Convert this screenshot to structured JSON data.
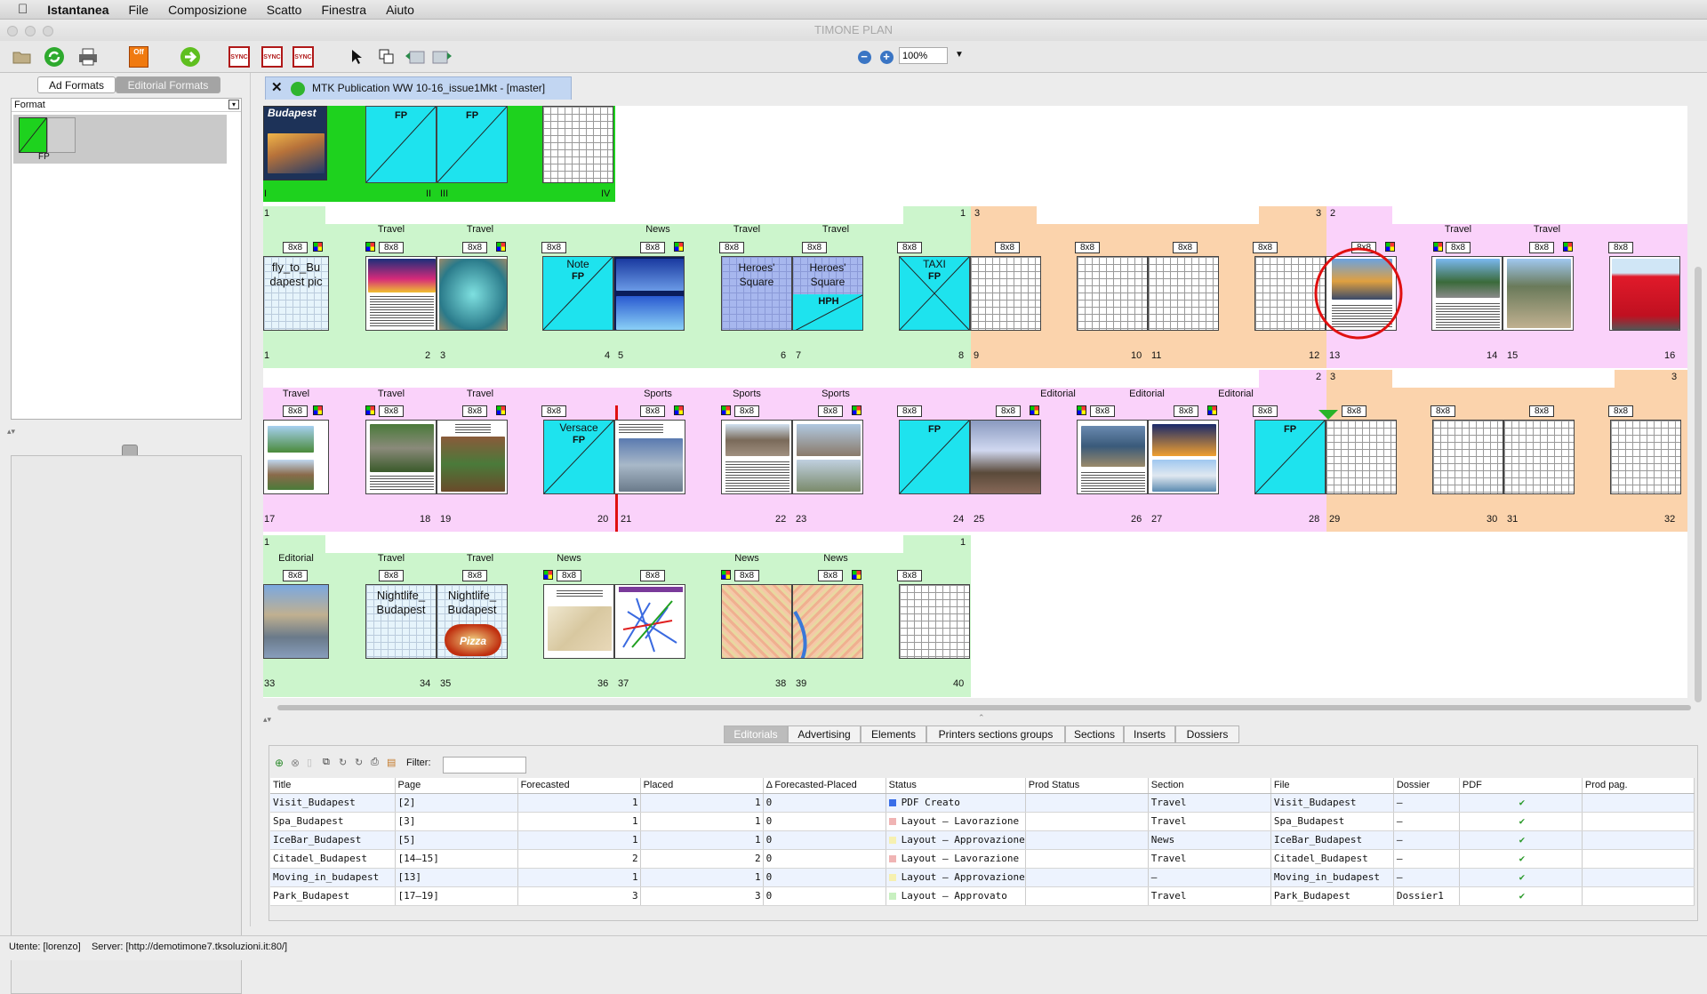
{
  "menubar": {
    "app": "Istantanea",
    "items": [
      "File",
      "Composizione",
      "Scatto",
      "Finestra",
      "Aiuto"
    ]
  },
  "window": {
    "title": "TIMONE PLAN"
  },
  "toolbar": {
    "zoom": "100%",
    "sync_label": "SYNC",
    "off_label": "Off"
  },
  "left_panel": {
    "tabs": [
      "Ad Formats",
      "Editorial Formats"
    ],
    "format_header": "Format",
    "format_item": "FP"
  },
  "doc_tab": {
    "title": "MTK Publication WW 10-16_issue1Mkt - [master]"
  },
  "flatplan": {
    "row0": {
      "labels": [
        "FP",
        "FP"
      ],
      "numbers": [
        "I",
        "II",
        "III",
        "IV"
      ],
      "cover_text": "Budapest"
    },
    "row1": {
      "sections": [
        "Travel",
        "Travel",
        "News",
        "Travel",
        "Travel",
        "Travel",
        "Travel"
      ],
      "tags": [
        "8x8",
        "8x8",
        "8x8",
        "8x8",
        "8x8",
        "8x8",
        "8x8",
        "8x8",
        "8x8",
        "8x8",
        "8x8",
        "8x8",
        "8x8",
        "8x8",
        "8x8",
        "8x8"
      ],
      "numbers": [
        "1",
        "2",
        "3",
        "4",
        "5",
        "6",
        "7",
        "8",
        "9",
        "10",
        "11",
        "12",
        "13",
        "14",
        "15",
        "16"
      ],
      "markers": [
        "1",
        "1",
        "3",
        "3",
        "2"
      ],
      "p1_text": "fly_to_Bu dapest pic",
      "p4_text": "Note",
      "p4_fp": "FP",
      "p6_text": "Heroes' Square",
      "p7_text": "Heroes' Square",
      "p7_hph": "HPH",
      "p8_text": "TAXI",
      "p8_fp": "FP"
    },
    "row2": {
      "sections": [
        "Travel",
        "Travel",
        "Travel",
        "Sports",
        "Sports",
        "Sports",
        "Editorial",
        "Editorial",
        "Editorial"
      ],
      "tags": [
        "8x8",
        "8x8",
        "8x8",
        "8x8",
        "8x8",
        "8x8",
        "8x8",
        "8x8",
        "8x8",
        "8x8",
        "8x8",
        "8x8",
        "8x8",
        "8x8",
        "8x8",
        "8x8"
      ],
      "numbers": [
        "17",
        "18",
        "19",
        "20",
        "21",
        "22",
        "23",
        "24",
        "25",
        "26",
        "27",
        "28",
        "29",
        "30",
        "31",
        "32"
      ],
      "markers": [
        "2",
        "3",
        "3"
      ],
      "p20_text": "Versace",
      "p20_fp": "FP",
      "p24_fp": "FP",
      "p28_fp": "FP"
    },
    "row3": {
      "sections": [
        "Editorial",
        "Travel",
        "Travel",
        "News",
        "News",
        "News"
      ],
      "tags": [
        "8x8",
        "8x8",
        "8x8",
        "8x8",
        "8x8",
        "8x8",
        "8x8"
      ],
      "numbers": [
        "33",
        "34",
        "35",
        "36",
        "37",
        "38",
        "39",
        "40"
      ],
      "markers": [
        "1",
        "1"
      ],
      "p34_text": "Nightlife_ Budapest",
      "p35_text": "Nightlife_ Budapest",
      "p35_pizza": "Pizza"
    }
  },
  "bottom_tabs": [
    "Editorials",
    "Advertising",
    "Elements",
    "Printers sections groups",
    "Sections",
    "Inserts",
    "Dossiers"
  ],
  "filter": {
    "label": "Filter:",
    "value": ""
  },
  "table": {
    "headers": [
      "Title",
      "Page",
      "Forecasted",
      "Placed",
      "Δ Forecasted-Placed",
      "Status",
      "Prod Status",
      "Section",
      "File",
      "Dossier",
      "PDF",
      "Prod pag."
    ],
    "rows": [
      {
        "title": "Visit_Budapest",
        "page": "[2]",
        "forecasted": "1",
        "placed": "1",
        "delta": "0",
        "status": "PDF Creato",
        "status_color": "#3a6ee8",
        "section": "Travel",
        "file": "Visit_Budapest",
        "dossier": "–",
        "pdf": "✔"
      },
      {
        "title": "Spa_Budapest",
        "page": "[3]",
        "forecasted": "1",
        "placed": "1",
        "delta": "0",
        "status": "Layout – Lavorazione",
        "status_color": "#f0b4b4",
        "section": "Travel",
        "file": "Spa_Budapest",
        "dossier": "–",
        "pdf": "✔"
      },
      {
        "title": "IceBar_Budapest",
        "page": "[5]",
        "forecasted": "1",
        "placed": "1",
        "delta": "0",
        "status": "Layout – Approvazione",
        "status_color": "#f6f0b0",
        "section": "News",
        "file": "IceBar_Budapest",
        "dossier": "–",
        "pdf": "✔"
      },
      {
        "title": "Citadel_Budapest",
        "page": "[14–15]",
        "forecasted": "2",
        "placed": "2",
        "delta": "0",
        "status": "Layout – Lavorazione",
        "status_color": "#f0b4b4",
        "section": "Travel",
        "file": "Citadel_Budapest",
        "dossier": "–",
        "pdf": "✔"
      },
      {
        "title": "Moving_in_budapest",
        "page": "[13]",
        "forecasted": "1",
        "placed": "1",
        "delta": "0",
        "status": "Layout – Approvazione",
        "status_color": "#f6f0b0",
        "section": "–",
        "file": "Moving_in_budapest",
        "dossier": "–",
        "pdf": "✔"
      },
      {
        "title": "Park_Budapest",
        "page": "[17–19]",
        "forecasted": "3",
        "placed": "3",
        "delta": "0",
        "status": "Layout – Approvato",
        "status_color": "#c8f0c0",
        "section": "Travel",
        "file": "Park_Budapest",
        "dossier": "Dossier1",
        "pdf": "✔"
      }
    ]
  },
  "status_bar": {
    "user": "Utente: [lorenzo]",
    "server": "Server: [http://demotimone7.tksoluzioni.it:80/]"
  },
  "colors": {
    "green_band": "#ccf5cc",
    "orange_band": "#fbd3ac",
    "pink_band": "#fad2fa",
    "bright_green": "#1ed21e",
    "cyan": "#1ee3ee"
  }
}
